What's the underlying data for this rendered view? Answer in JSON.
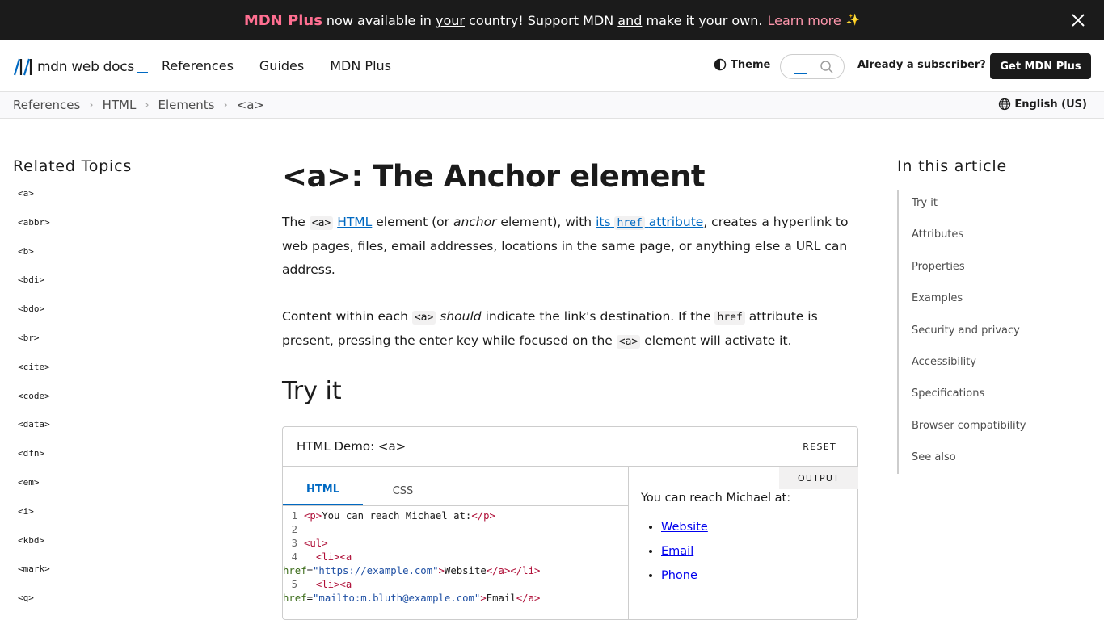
{
  "banner": {
    "brand": "MDN Plus",
    "text_1": "now available in",
    "text_your": "your",
    "text_2": "country! Support MDN",
    "text_and": "and",
    "text_3": "make it your own.",
    "learn_more": "Learn more",
    "sparkle_icon": "sparkles-icon",
    "close_icon": "close-icon"
  },
  "header": {
    "logo_text": "mdn web docs",
    "nav": [
      "References",
      "Guides",
      "MDN Plus"
    ],
    "theme_label": "Theme",
    "search_placeholder": "",
    "subscriber_link": "Already a subscriber?",
    "cta": "Get MDN Plus"
  },
  "breadcrumb": [
    "References",
    "HTML",
    "Elements",
    "<a>"
  ],
  "language": "English (US)",
  "sidebar": {
    "title": "Related Topics",
    "items": [
      "<a>",
      "<abbr>",
      "<b>",
      "<bdi>",
      "<bdo>",
      "<br>",
      "<cite>",
      "<code>",
      "<data>",
      "<dfn>",
      "<em>",
      "<i>",
      "<kbd>",
      "<mark>",
      "<q>"
    ]
  },
  "article": {
    "title": "<a>: The Anchor element",
    "p1": {
      "t1": "The",
      "code_a": "<a>",
      "link_html": "HTML",
      "t2": "element (or",
      "em_anchor": "anchor",
      "t3": "element), with",
      "link_its": "its",
      "code_href": "href",
      "link_attribute": "attribute",
      "t4": ", creates a hyperlink to web pages, files, email addresses, locations in the same page, or anything else a URL can address."
    },
    "p2": {
      "t1": "Content within each",
      "code_a": "<a>",
      "em_should": "should",
      "t2": "indicate the link's destination. If the",
      "code_href": "href",
      "t3": "attribute is present, pressing the enter key while focused on the",
      "code_a2": "<a>",
      "t4": "element will activate it."
    },
    "h2_try": "Try it"
  },
  "demo": {
    "title": "HTML Demo: <a>",
    "reset": "RESET",
    "tabs": [
      "HTML",
      "CSS"
    ],
    "output_label": "OUTPUT",
    "line_numbers": [
      "1",
      "2",
      "3",
      "4",
      "5"
    ],
    "code": {
      "l1_open": "<p>",
      "l1_text": "You can reach Michael at:",
      "l1_close": "</p>",
      "l3": "<ul>",
      "li_open": "<li>",
      "a_open": "<a",
      "href_attr": "href",
      "href_1": "\"https://example.com\"",
      "text_1": "Website",
      "a_close": "</a>",
      "li_close": "</li>",
      "href_2": "\"mailto:m.bluth@example.com\"",
      "text_2": "Email",
      "eq": "=",
      "gt": ">"
    },
    "output_text": "You can reach Michael at:",
    "output_links": [
      "Website",
      "Email",
      "Phone"
    ]
  },
  "toc": {
    "title": "In this article",
    "items": [
      "Try it",
      "Attributes",
      "Properties",
      "Examples",
      "Security and privacy",
      "Accessibility",
      "Specifications",
      "Browser compatibility",
      "See also"
    ]
  }
}
